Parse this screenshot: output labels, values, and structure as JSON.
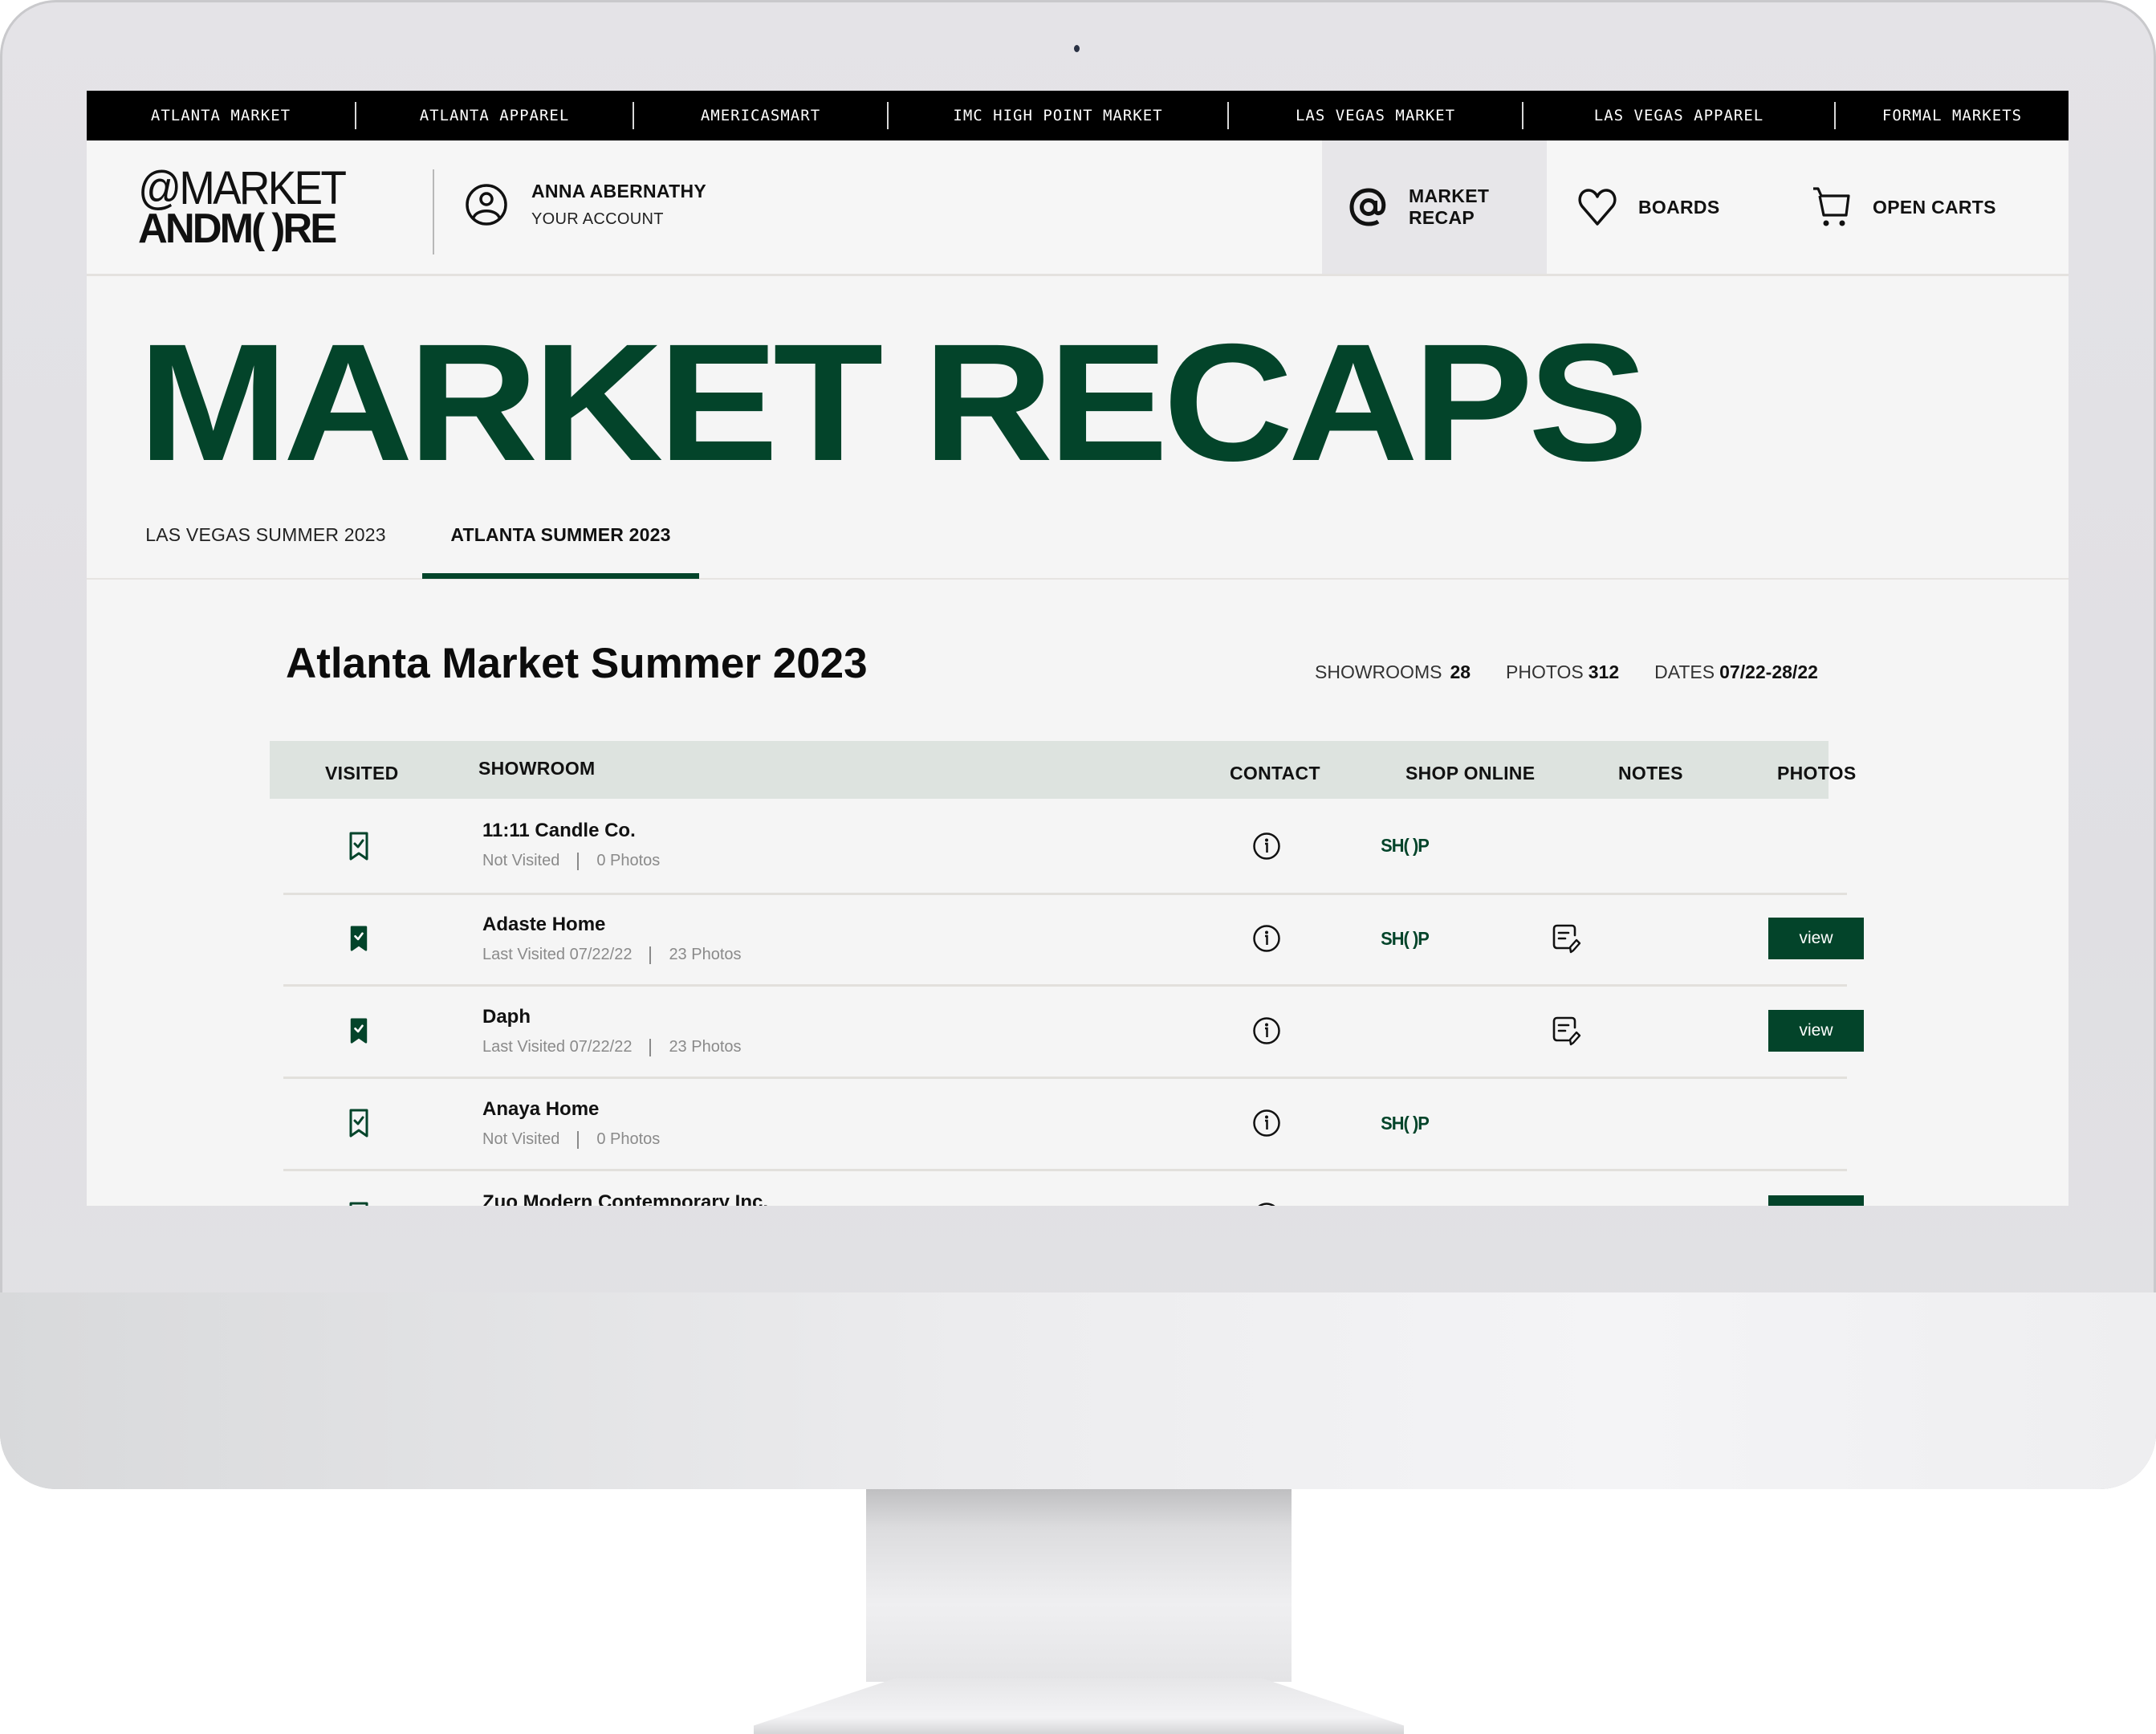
{
  "topbar": {
    "items": [
      "ATLANTA MARKET",
      "ATLANTA APPAREL",
      "AMERICASMART",
      "IMC HIGH POINT MARKET",
      "LAS VEGAS MARKET",
      "LAS VEGAS APPAREL",
      "FORMAL MARKETS"
    ]
  },
  "header": {
    "logo_line1": "@MARKET",
    "logo_line2": "ANDM( )RE",
    "account_name": "ANNA ABERNATHY",
    "account_sub": "YOUR ACCOUNT",
    "nav": [
      {
        "label": "MARKET RECAP",
        "icon": "at-sign-icon",
        "active": true
      },
      {
        "label": "BOARDS",
        "icon": "heart-icon",
        "active": false
      },
      {
        "label": "OPEN CARTS",
        "icon": "cart-icon",
        "active": false
      }
    ]
  },
  "page": {
    "title": "MARKET RECAPS",
    "tabs": [
      {
        "label": "LAS VEGAS SUMMER 2023",
        "active": false
      },
      {
        "label": "ATLANTA SUMMER 2023",
        "active": true
      }
    ]
  },
  "recap": {
    "title": "Atlanta Market Summer 2023",
    "stats": {
      "showrooms_label": "SHOWROOMS",
      "showrooms_value": "28",
      "photos_label": "PHOTOS",
      "photos_value": "312",
      "dates_label": "DATES",
      "dates_value": "07/22-28/22"
    },
    "columns": [
      "VISITED",
      "SHOWROOM",
      "CONTACT",
      "SHOP ONLINE",
      "NOTES",
      "PHOTOS"
    ],
    "shop_label": "SH( )P",
    "view_label": "view",
    "rows": [
      {
        "name": "11:11 Candle Co.",
        "status": "Not Visited",
        "photos": "0 Photos",
        "visited": false,
        "shop": true,
        "notes": false,
        "view": false
      },
      {
        "name": "Adaste Home",
        "status": "Last Visited 07/22/22",
        "photos": "23 Photos",
        "visited": true,
        "shop": true,
        "notes": true,
        "view": true
      },
      {
        "name": "Daph",
        "status": "Last Visited 07/22/22",
        "photos": "23 Photos",
        "visited": true,
        "shop": false,
        "notes": true,
        "view": true
      },
      {
        "name": "Anaya Home",
        "status": "Not Visited",
        "photos": "0 Photos",
        "visited": false,
        "shop": true,
        "notes": false,
        "view": false
      },
      {
        "name": "Zuo Modern Contemporary Inc.",
        "status": "",
        "photos": "",
        "visited": false,
        "shop": false,
        "notes": false,
        "view": true
      }
    ]
  },
  "colors": {
    "brand_green": "#03442a",
    "table_header_bg": "#dde3df",
    "active_nav_bg": "#e7e6e9"
  }
}
